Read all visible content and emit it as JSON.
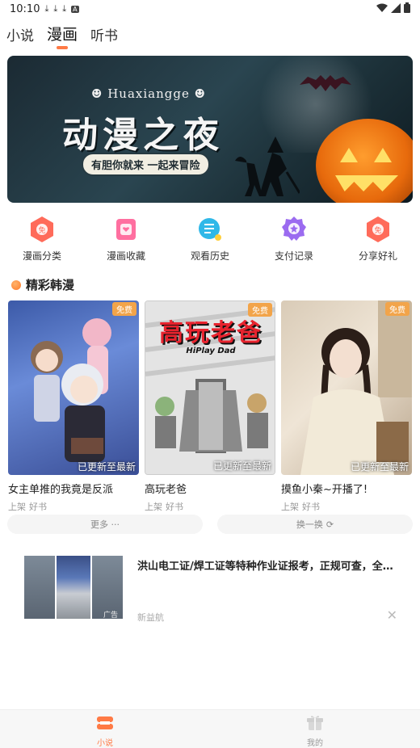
{
  "status_bar": {
    "time": "10:10",
    "download_icons": [
      "download-icon",
      "download-icon",
      "download-icon",
      "a-icon"
    ],
    "right_icons": [
      "wifi-icon",
      "signal-icon",
      "battery-icon"
    ]
  },
  "top_tabs": [
    {
      "label": "小说",
      "active": false
    },
    {
      "label": "漫画",
      "active": true
    },
    {
      "label": "听书",
      "active": false
    }
  ],
  "accent_color": "#ff7a45",
  "banner": {
    "brand": "Huaxiangge",
    "title": "动漫之夜",
    "tagline": "有胆你就来 一起来冒险"
  },
  "quick_entries": [
    {
      "label": "漫画分类",
      "icon": "category-icon",
      "color": "#ff6b5a"
    },
    {
      "label": "漫画收藏",
      "icon": "collection-icon",
      "color": "#ff6fa0"
    },
    {
      "label": "观看历史",
      "icon": "history-icon",
      "color": "#2fb8e8"
    },
    {
      "label": "支付记录",
      "icon": "payment-icon",
      "color": "#9b6bf0"
    },
    {
      "label": "分享好礼",
      "icon": "share-gift-icon",
      "color": "#ff6b5a"
    }
  ],
  "section": {
    "title": "精彩韩漫"
  },
  "manga_cards": [
    {
      "title": "女主单推的我竟是反派",
      "badge": "免费",
      "status": "已更新至最新",
      "tags": [
        "上架",
        "好书"
      ]
    },
    {
      "title": "高玩老爸",
      "badge": "免费",
      "status": "已更新至最新",
      "tags": [
        "上架",
        "好书"
      ],
      "cover_text": "高玩老爸",
      "cover_subtext": "HiPlay Dad"
    },
    {
      "title": "摸鱼小秦~开播了!",
      "badge": "免费",
      "status": "已更新至最新",
      "tags": [
        "上架",
        "好书"
      ]
    }
  ],
  "actions": {
    "more_label": "更多 ···",
    "refresh_label": "换一换"
  },
  "ad": {
    "title": "洪山电工证/焊工证等特种作业证报考，正规可查，全程...",
    "source": "新益航",
    "tag": "广告"
  },
  "bottom_nav": [
    {
      "label": "小说",
      "active": true,
      "icon": "novel-icon"
    },
    {
      "label": "我的",
      "active": false,
      "icon": "profile-icon"
    }
  ]
}
